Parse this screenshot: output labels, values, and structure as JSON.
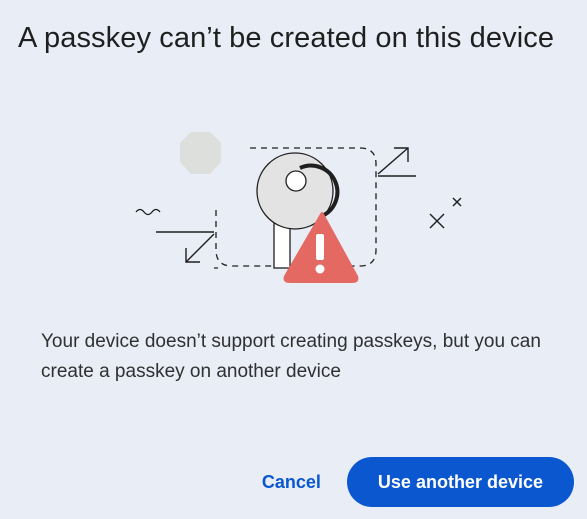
{
  "dialog": {
    "title": "A passkey can’t be created on this device",
    "message": "Your device doesn’t support creating passkeys, but you can create a passkey on another device",
    "illustration": {
      "icon": "passkey-key-warning-icon",
      "warning_color": "#e46962",
      "key_color": "#e3e3e3",
      "octagon_color": "#dcdfdc"
    },
    "actions": {
      "cancel_label": "Cancel",
      "primary_label": "Use another device"
    },
    "colors": {
      "background": "#e8edf6",
      "accent": "#0b57d0"
    }
  }
}
